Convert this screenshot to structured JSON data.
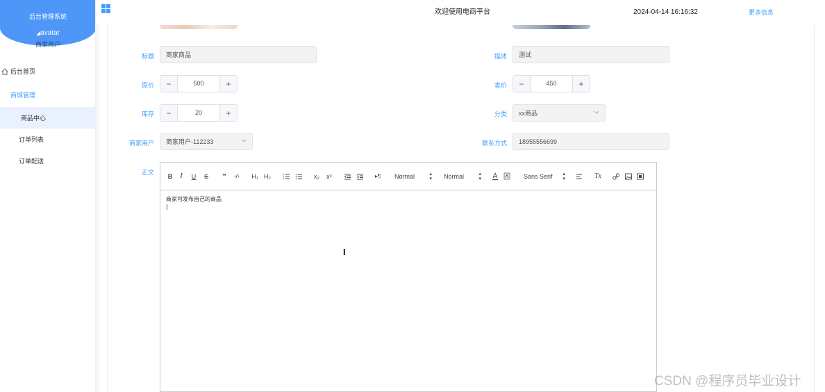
{
  "sidebar": {
    "brand_title": "后台管理系统",
    "avatar_text": "avatar",
    "user_name": "商家用户",
    "items": [
      {
        "label": "后台首页",
        "icon": "home-icon"
      },
      {
        "label": "商城管理"
      },
      {
        "label": "商品中心",
        "active": true
      },
      {
        "label": "订单列表"
      },
      {
        "label": "订单配送"
      }
    ]
  },
  "topbar": {
    "title": "欢迎使用电商平台",
    "datetime": "2024-04-14 16:16:32",
    "more": "更多信息"
  },
  "form": {
    "title_label": "标题",
    "title_value": "商家商品",
    "desc_label": "描述",
    "desc_value": "测试",
    "orig_price_label": "原价",
    "orig_price_value": "500",
    "sale_price_label": "卖价",
    "sale_price_value": "450",
    "stock_label": "库存",
    "stock_value": "20",
    "category_label": "分类",
    "category_value": "xx商品",
    "merchant_label": "商家用户",
    "merchant_value": "商家用户-112233",
    "contact_label": "联系方式",
    "contact_value": "18955556699",
    "body_label": "正文"
  },
  "editor": {
    "toolbar": {
      "bold": "B",
      "italic": "I",
      "underline": "U",
      "strike": "S",
      "quote": "❞",
      "code": "‹/›",
      "h1": "H₁",
      "h2": "H₂",
      "sub": "x₂",
      "sup": "x²",
      "direction": "▸¶",
      "size_select": "Normal",
      "header_select": "Normal",
      "font_select": "Sans Serif",
      "clean": "Tx"
    },
    "content": "商家可发布自己的商品"
  },
  "watermark": "CSDN @程序员毕业设计",
  "colors": {
    "accent": "#409eff",
    "brand": "#4e96f7",
    "active_bg": "#e8f1fd"
  }
}
